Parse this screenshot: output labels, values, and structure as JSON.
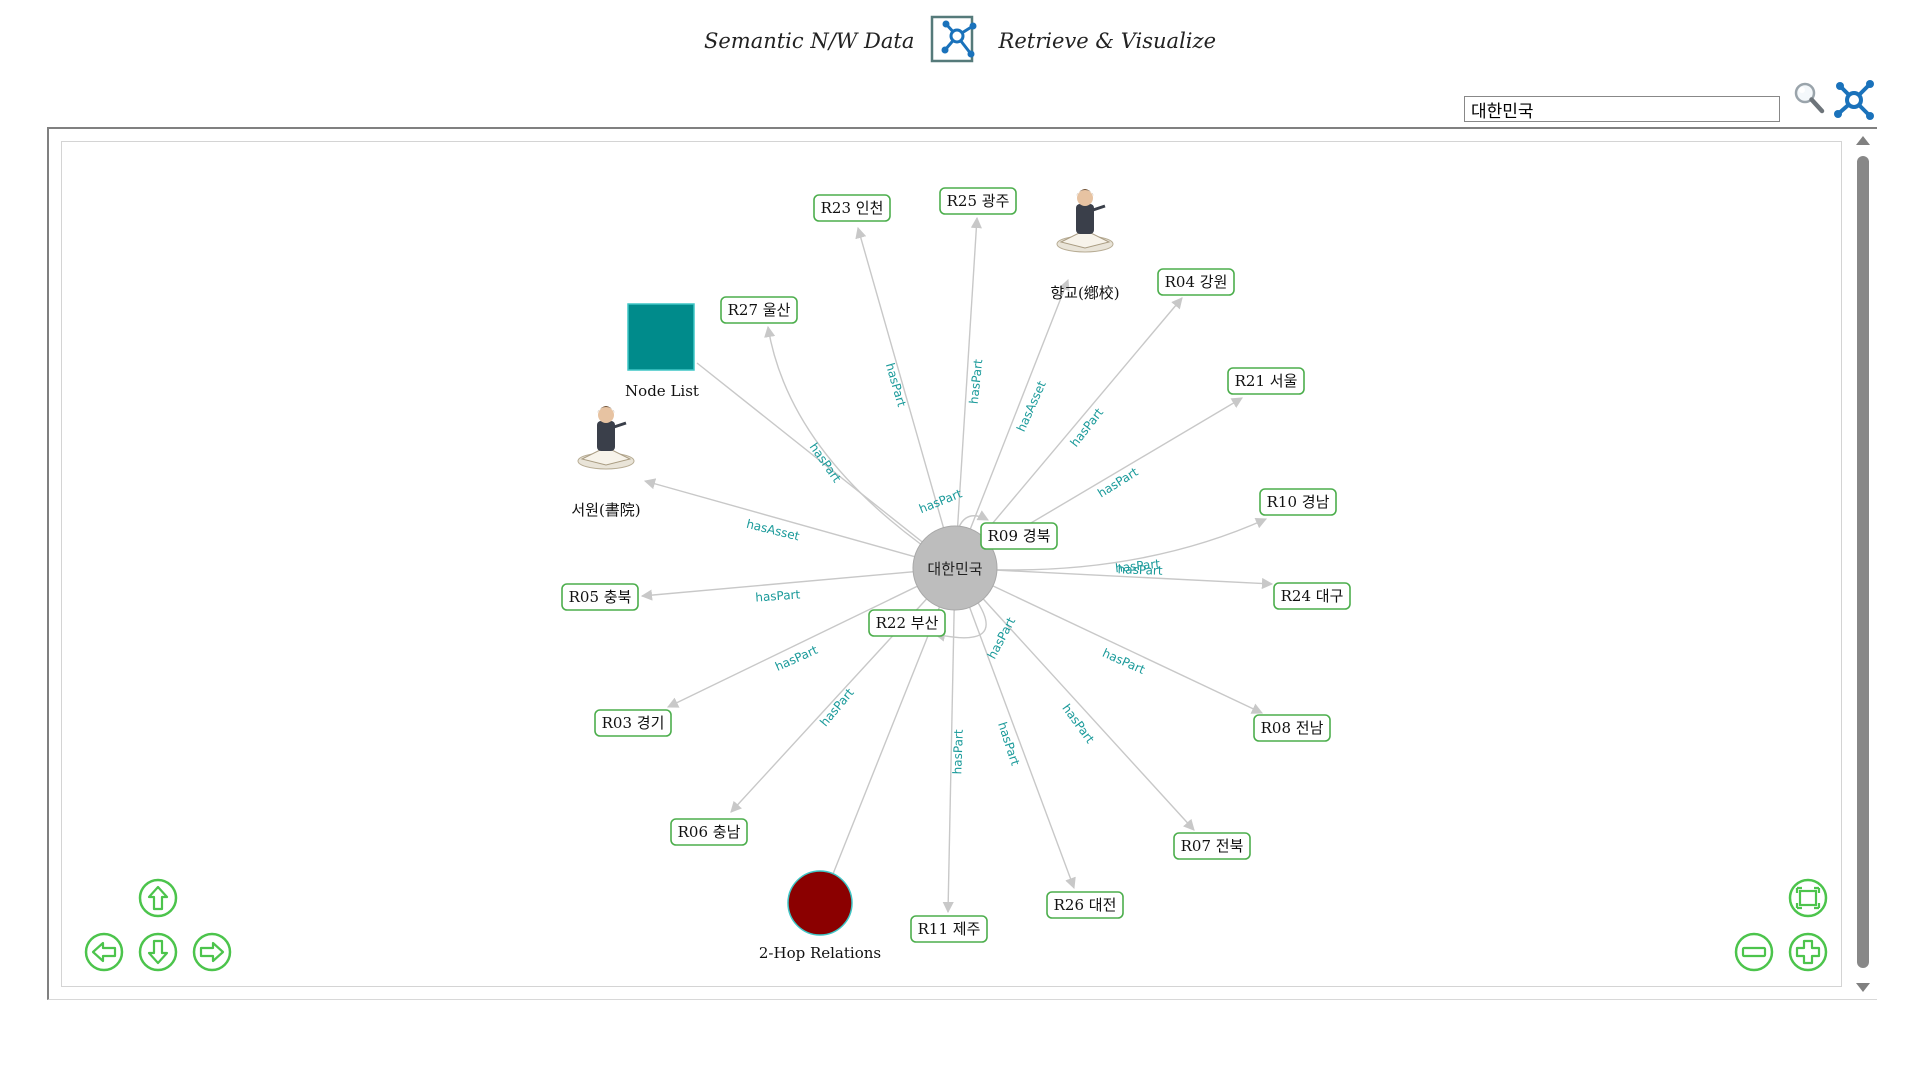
{
  "header": {
    "title_left": "Semantic N/W Data",
    "title_right": "Retrieve & Visualize",
    "logo_icon": "network-graph-icon"
  },
  "search": {
    "value": "대한민국",
    "search_icon": "magnifier-icon",
    "network_icon": "network-icon"
  },
  "colors": {
    "node_border": "#4cae4c",
    "edge": "#c8c8c8",
    "edge_label": "#1a9a9a",
    "center_node": "#bdbdbd",
    "node_list_square": "#008b8b",
    "two_hop_circle": "#8b0000",
    "nav_button": "#4cc44c"
  },
  "graph": {
    "center": "대한민국",
    "nodes": [
      {
        "id": "R23",
        "label": "R23 인천",
        "edge": "hasPart"
      },
      {
        "id": "R25",
        "label": "R25 광주",
        "edge": "hasPart"
      },
      {
        "id": "hyanggyo",
        "label": "향교(鄕校)",
        "edge": "hasAsset",
        "kind": "person"
      },
      {
        "id": "R04",
        "label": "R04 강원",
        "edge": "hasPart"
      },
      {
        "id": "R21",
        "label": "R21 서울",
        "edge": "hasPart"
      },
      {
        "id": "R10",
        "label": "R10 경남",
        "edge": "hasPart"
      },
      {
        "id": "R24",
        "label": "R24 대구",
        "edge": "hasPart"
      },
      {
        "id": "R08",
        "label": "R08 전남",
        "edge": "hasPart"
      },
      {
        "id": "R07",
        "label": "R07 전북",
        "edge": "hasPart"
      },
      {
        "id": "R26",
        "label": "R26 대전",
        "edge": "hasPart"
      },
      {
        "id": "R11",
        "label": "R11 제주",
        "edge": "hasPart"
      },
      {
        "id": "twohop",
        "label": "2-Hop Relations",
        "kind": "circle"
      },
      {
        "id": "R06",
        "label": "R06 충남",
        "edge": "hasPart"
      },
      {
        "id": "R03",
        "label": "R03 경기",
        "edge": "hasPart"
      },
      {
        "id": "R05",
        "label": "R05 충북",
        "edge": "hasPart"
      },
      {
        "id": "seowon",
        "label": "서원(書院)",
        "edge": "hasAsset",
        "kind": "person"
      },
      {
        "id": "nodelist",
        "label": "Node List",
        "kind": "square"
      },
      {
        "id": "R27",
        "label": "R27 울산",
        "edge": "hasPart"
      },
      {
        "id": "R09",
        "label": "R09 경북",
        "edge": "hasPart"
      },
      {
        "id": "R22",
        "label": "R22 부산",
        "edge": "hasPart"
      }
    ]
  },
  "controls": {
    "up": "arrow-up-icon",
    "down": "arrow-down-icon",
    "left": "arrow-left-icon",
    "right": "arrow-right-icon",
    "fit": "fit-screen-icon",
    "zoom_out": "zoom-out-icon",
    "zoom_in": "zoom-in-icon"
  }
}
